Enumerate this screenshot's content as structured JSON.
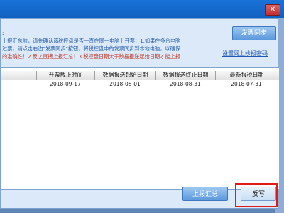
{
  "window": {
    "close_label": "✕"
  },
  "notice": {
    "label": ":",
    "lines": [
      "上报汇总前，请先确认该税控盘是否一直在同一电脑上开票：1.如果在多台电脑",
      "过票，请点击右边\"发票同步\"按钮，将税控盘中的发票同步到本地电脑，以确保",
      "的准确性！2.反之直接上报汇总！3.税控盘日期大于数据报送起始日期才能上报"
    ]
  },
  "actions": {
    "sync_label": "发票同步",
    "reset_link": "设置网上抄报密码",
    "summary_label": "上报汇总",
    "writeback_label": "反写"
  },
  "table": {
    "headers": [
      "开票截止时间",
      "数据报送起始日期",
      "数据报送终止日期",
      "最新报税日期"
    ],
    "rows": [
      [
        "2018-09-17",
        "2018-08-01",
        "2018-08-31",
        "2018-07-31"
      ]
    ]
  },
  "colors": {
    "titlebar": "#1a73d8",
    "dialog_bg": "#dbe9f8",
    "accent_button": "#5a98dd",
    "highlight": "#e01919"
  }
}
